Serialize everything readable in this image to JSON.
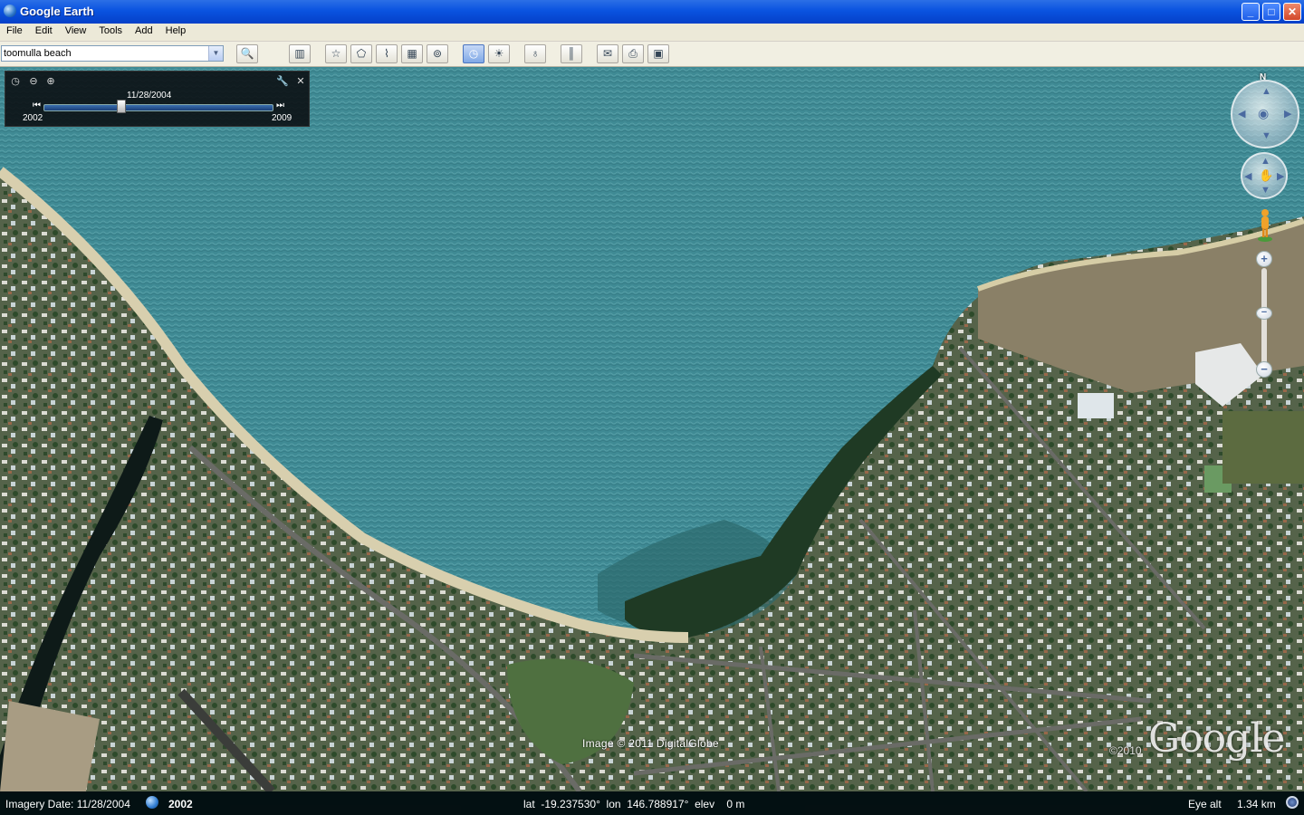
{
  "window": {
    "title": "Google Earth",
    "controls": {
      "minimize": "_",
      "maximize": "□",
      "close": "✕"
    }
  },
  "menu": [
    "File",
    "Edit",
    "View",
    "Tools",
    "Add",
    "Help"
  ],
  "search": {
    "value": "toomulla beach"
  },
  "toolbar": {
    "buttons": [
      {
        "name": "search-icon",
        "glyph": "🔍"
      },
      {
        "name": "sidebar-toggle-icon",
        "glyph": "▥"
      },
      {
        "name": "placemark-icon",
        "glyph": "☆"
      },
      {
        "name": "polygon-icon",
        "glyph": "⬠"
      },
      {
        "name": "path-icon",
        "glyph": "⌇"
      },
      {
        "name": "image-overlay-icon",
        "glyph": "▦"
      },
      {
        "name": "record-tour-icon",
        "glyph": "⊚"
      },
      {
        "name": "historical-imagery-icon",
        "glyph": "◷"
      },
      {
        "name": "sunlight-icon",
        "glyph": "☀"
      },
      {
        "name": "planet-icon",
        "glyph": "♁"
      },
      {
        "name": "ruler-icon",
        "glyph": "║"
      },
      {
        "name": "email-icon",
        "glyph": "✉"
      },
      {
        "name": "print-icon",
        "glyph": "⎙"
      },
      {
        "name": "save-image-icon",
        "glyph": "▣"
      }
    ]
  },
  "time_slider": {
    "current_date": "11/28/2004",
    "start_year": "2002",
    "end_year": "2009",
    "position": 0.34
  },
  "nav": {
    "north_label": "N"
  },
  "zoom": {
    "plus": "+",
    "minus": "−",
    "level": 0.55
  },
  "map_overlay": {
    "copyright": "Image © 2011 DigitalGlobe",
    "logo_year": "©2010",
    "logo": "Google"
  },
  "status": {
    "imagery_date": "Imagery Date: 11/28/2004",
    "imagery_year": "2002",
    "coords": "lat  -19.237530°  lon  146.788917°  elev    0 m",
    "eye_alt_label": "Eye alt",
    "eye_alt_value": "1.34 km"
  },
  "colors": {
    "water": "#3f8a94",
    "land": "#5d6a4a",
    "titlebar": "#0a53e0"
  }
}
